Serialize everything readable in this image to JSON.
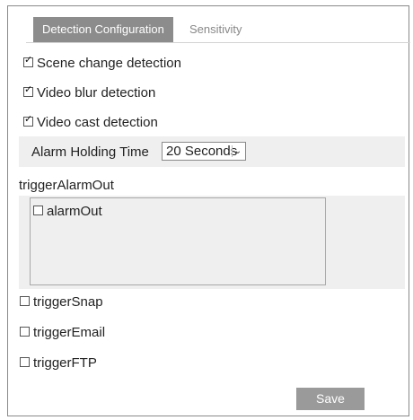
{
  "tabs": [
    {
      "label": "Detection Configuration",
      "active": true
    },
    {
      "label": "Sensitivity",
      "active": false
    }
  ],
  "detections": [
    {
      "label": "Scene change detection",
      "checked": true
    },
    {
      "label": "Video blur detection",
      "checked": true
    },
    {
      "label": "Video cast detection",
      "checked": true
    }
  ],
  "alarm_holding": {
    "label": "Alarm Holding Time",
    "selected": "20 Seconds"
  },
  "trigger_alarm_out": {
    "label": "triggerAlarmOut",
    "items": [
      {
        "label": "alarmOut",
        "checked": false
      }
    ]
  },
  "triggers": [
    {
      "label": "triggerSnap",
      "checked": false
    },
    {
      "label": "triggerEmail",
      "checked": false
    },
    {
      "label": "triggerFTP",
      "checked": false
    }
  ],
  "save_label": "Save",
  "icons": {
    "checked": "check-icon",
    "dropdown": "chevron-down-icon"
  },
  "colors": {
    "active_tab_bg": "#8c8c8c",
    "band_bg": "#efefef",
    "save_bg": "#9a9a9a"
  }
}
